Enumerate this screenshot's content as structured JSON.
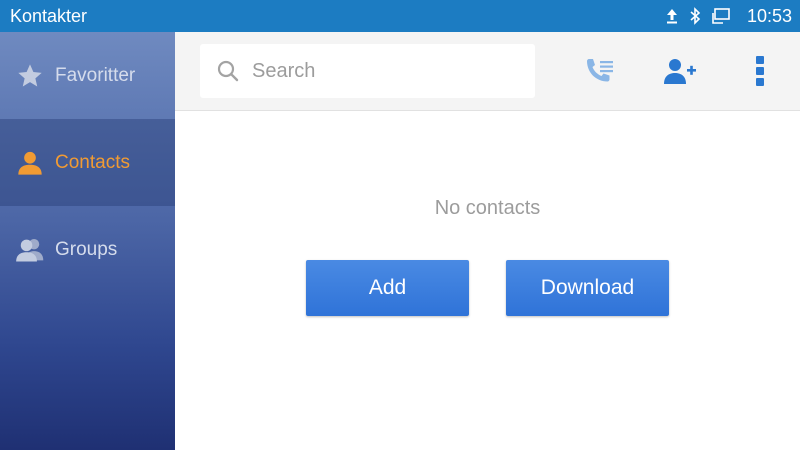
{
  "status_bar": {
    "title": "Kontakter",
    "time": "10:53",
    "icons": [
      "upload-icon",
      "bluetooth-icon",
      "network-icon"
    ],
    "background": "#1c7cc2"
  },
  "sidebar": {
    "items": [
      {
        "label": "Favoritter",
        "icon": "star-icon",
        "active": false
      },
      {
        "label": "Contacts",
        "icon": "person-icon",
        "active": true
      },
      {
        "label": "Groups",
        "icon": "group-icon",
        "active": false
      }
    ],
    "active_color": "#f19b33"
  },
  "toolbar": {
    "search_placeholder": "Search",
    "actions": [
      "call-log-icon",
      "add-contact-icon",
      "more-menu-icon"
    ],
    "icon_color": "#2a78d0"
  },
  "main": {
    "empty_text": "No contacts",
    "add_label": "Add",
    "download_label": "Download",
    "button_color": "#3a7ddd"
  }
}
